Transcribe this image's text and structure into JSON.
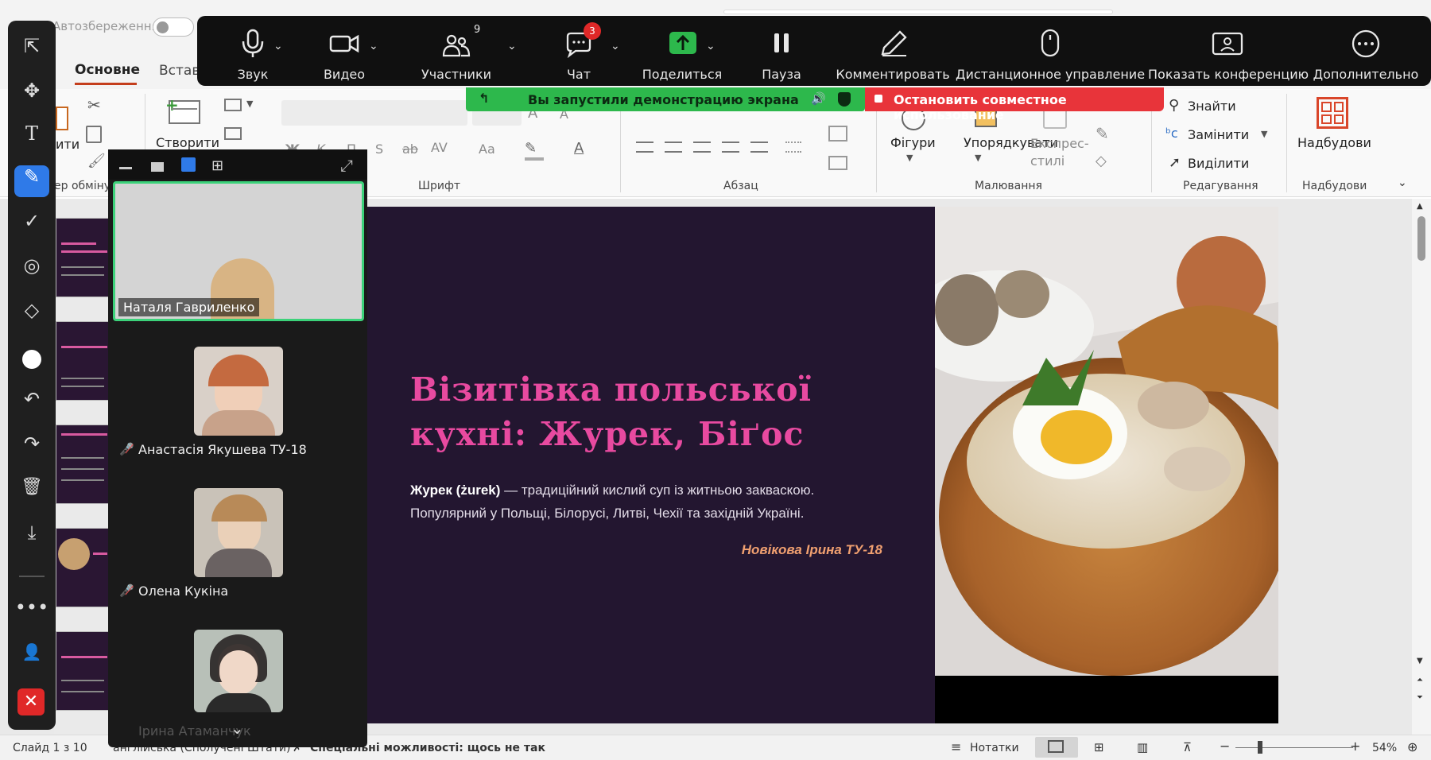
{
  "powerpoint": {
    "autosave_label": "Автозбереження",
    "tab_home": "Основне",
    "tab_insert": "Встав",
    "cut_hint": "ити",
    "clipboard_label": "ер обміну",
    "create_label": "Створити",
    "group_font": "Шрифт",
    "group_paragraph": "Абзац",
    "group_drawing": "Малювання",
    "group_editing": "Редагування",
    "group_addins": "Надбудови",
    "shapes_label": "Фігури",
    "arrange_label": "Упорядкувати",
    "quick_styles_label": "Експрес-\nстилі",
    "find_label": "Знайти",
    "replace_label": "Замінити",
    "select_label": "Виділити",
    "addins_label": "Надбудови"
  },
  "slide": {
    "title": "Візитівка польської кухні: Журек, Біґос",
    "body_bold": "Журек (żurek)",
    "body_rest1": " — традиційний кислий суп із житньою закваскою.",
    "body_line2": "Популярний у Польщі, Білорусі, Литві, Чехії та західній Україні.",
    "author": "Новікова Ірина ТУ-18"
  },
  "status_bar": {
    "slide_counter": "Слайд 1 з 10",
    "language": "англійська (Сполучені Штати)",
    "accessibility": "Спеціальні можливості: щось не так",
    "notes": "Нотатки",
    "zoom": "54%"
  },
  "zoom_toolbar": {
    "audio": "Звук",
    "video": "Видео",
    "participants": "Участники",
    "participants_count": "9",
    "chat": "Чат",
    "chat_badge": "3",
    "share": "Поделиться",
    "pause": "Пауза",
    "annotate": "Комментировать",
    "remote_control": "Дистанционное управление",
    "show_meeting": "Показать конференцию",
    "more": "Дополнительно"
  },
  "share_banner": {
    "sharing_text": "Вы запустили демонстрацию экрана",
    "stop_text": "Остановить совместное использование"
  },
  "participants_panel": {
    "active_speaker": "Наталя Гавриленко",
    "p1": "Анастасія Якушева ТУ-18",
    "p2": "Олена Кукіна",
    "p3": "Ірина Атаманчук"
  },
  "colors": {
    "slide_bg": "#231630",
    "title_pink": "#e84aa0",
    "author_orange": "#f0a070",
    "share_green": "#2db84c",
    "stop_red": "#e8343a"
  }
}
